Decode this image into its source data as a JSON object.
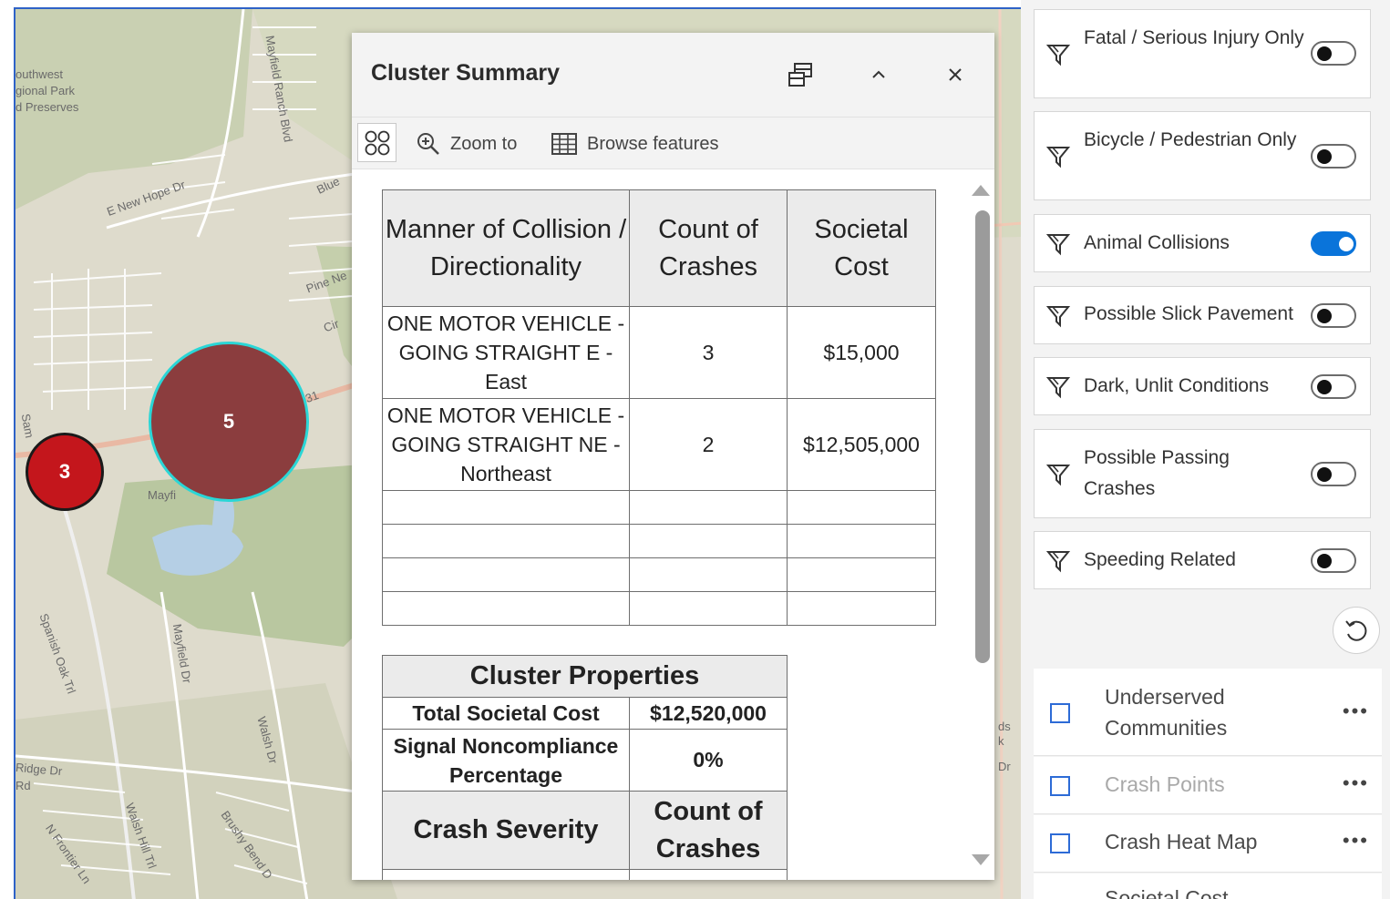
{
  "map": {
    "labels": {
      "park_line1": "outhwest",
      "park_line2": "gional Park",
      "park_line3": "d Preserves",
      "mayfield_ranch": "Mayfield Ranch Blvd",
      "new_hope": "E New Hope Dr",
      "blue": "Blue",
      "pine": "Pine Ne",
      "cir": "Cir",
      "num_31": "31",
      "sam": "Sam",
      "mayf": "Mayfi",
      "spanish_oak": "Spanish Oak Trl",
      "mayfield_dr": "Mayfield Dr",
      "walsh_dr": "Walsh Dr",
      "ridge": "Ridge Dr",
      "rd": "Rd",
      "walsh_hill": "Walsh Hill Trl",
      "brushy": "Brushy Bend D",
      "frontier": "N Frontier Ln",
      "ds": "ds",
      "k": "k",
      "dr_right": "Dr"
    },
    "clusters": [
      {
        "count": "3",
        "color": "#c4161c"
      },
      {
        "count": "5",
        "color": "#8b3d3e"
      }
    ]
  },
  "popup": {
    "title": "Cluster Summary",
    "dock_icon": "dock-icon",
    "collapse_icon": "chevron-up-icon",
    "close_icon": "close-icon",
    "toolbar": {
      "cluster_icon": "cluster-icon",
      "zoom_label": "Zoom to",
      "browse_label": "Browse features"
    },
    "table1": {
      "headers": [
        "Manner of Collision / Directionality",
        "Count of Crashes",
        "Societal Cost"
      ],
      "rows": [
        [
          "ONE MOTOR VEHICLE - GOING STRAIGHT E - East",
          "3",
          "$15,000"
        ],
        [
          "ONE MOTOR VEHICLE - GOING STRAIGHT NE - Northeast",
          "2",
          "$12,505,000"
        ]
      ]
    },
    "table2": {
      "title": "Cluster Properties",
      "total_label": "Total Societal Cost",
      "total_value": "$12,520,000",
      "signal_label": "Signal Noncompliance Percentage",
      "signal_value": "0%",
      "severity_header": "Crash Severity",
      "count_header": "Count of Crashes"
    }
  },
  "panel": {
    "filters": [
      {
        "label": "Fatal / Serious Injury Only",
        "on": false
      },
      {
        "label": "Bicycle / Pedestrian Only",
        "on": false
      },
      {
        "label": "Animal Collisions",
        "on": true
      },
      {
        "label": "Possible Slick Pavement",
        "on": false
      },
      {
        "label": "Dark, Unlit Conditions",
        "on": false
      },
      {
        "label": "Possible Passing Crashes",
        "on": false
      },
      {
        "label": "Speeding Related",
        "on": false
      }
    ],
    "reset_icon": "reset-icon",
    "layers": [
      {
        "label": "Underserved Communities",
        "more": "•••"
      },
      {
        "label": "Crash Points",
        "more": "•••"
      },
      {
        "label": "Crash Heat Map",
        "more": "•••"
      },
      {
        "label": "Societal Cost",
        "more": ""
      }
    ],
    "colors": {
      "accent": "#0a74da",
      "checkbox": "#2d6bd6"
    }
  }
}
